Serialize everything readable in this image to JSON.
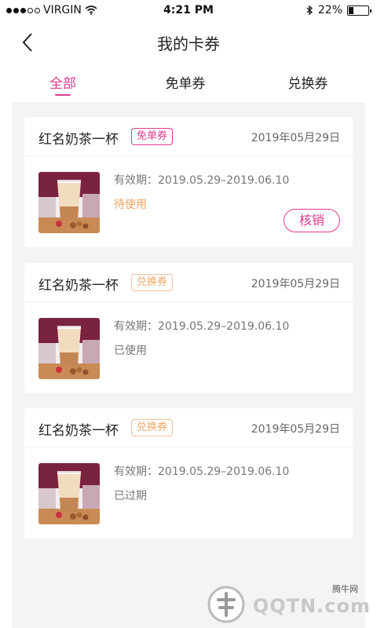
{
  "status_bar": {
    "carrier": "VIRGIN",
    "time": "4:21 PM",
    "battery": "22%"
  },
  "nav": {
    "title": "我的卡券"
  },
  "tabs": [
    {
      "label": "全部",
      "active": true
    },
    {
      "label": "免单券",
      "active": false
    },
    {
      "label": "兑换券",
      "active": false
    }
  ],
  "coupons": [
    {
      "name": "红名奶茶一杯",
      "tag": "免单券",
      "date": "2019年05月29日",
      "validity": "有效期：2019.05.29–2019.06.10",
      "status": "待使用",
      "action": "核销"
    },
    {
      "name": "红名奶茶一杯",
      "tag": "兑换券",
      "date": "2019年05月29日",
      "validity": "有效期：2019.05.29–2019.06.10",
      "status": "已使用"
    },
    {
      "name": "红名奶茶一杯",
      "tag": "兑换券",
      "date": "2019年05月29日",
      "validity": "有效期：2019.05.29–2019.06.10",
      "status": "已过期"
    }
  ],
  "watermark": {
    "small": "腾牛网",
    "big": "QQTN.com"
  },
  "colors": {
    "accent": "#e03a8f",
    "orange_tag": "#f3a765",
    "background": "#f4f4f4"
  }
}
